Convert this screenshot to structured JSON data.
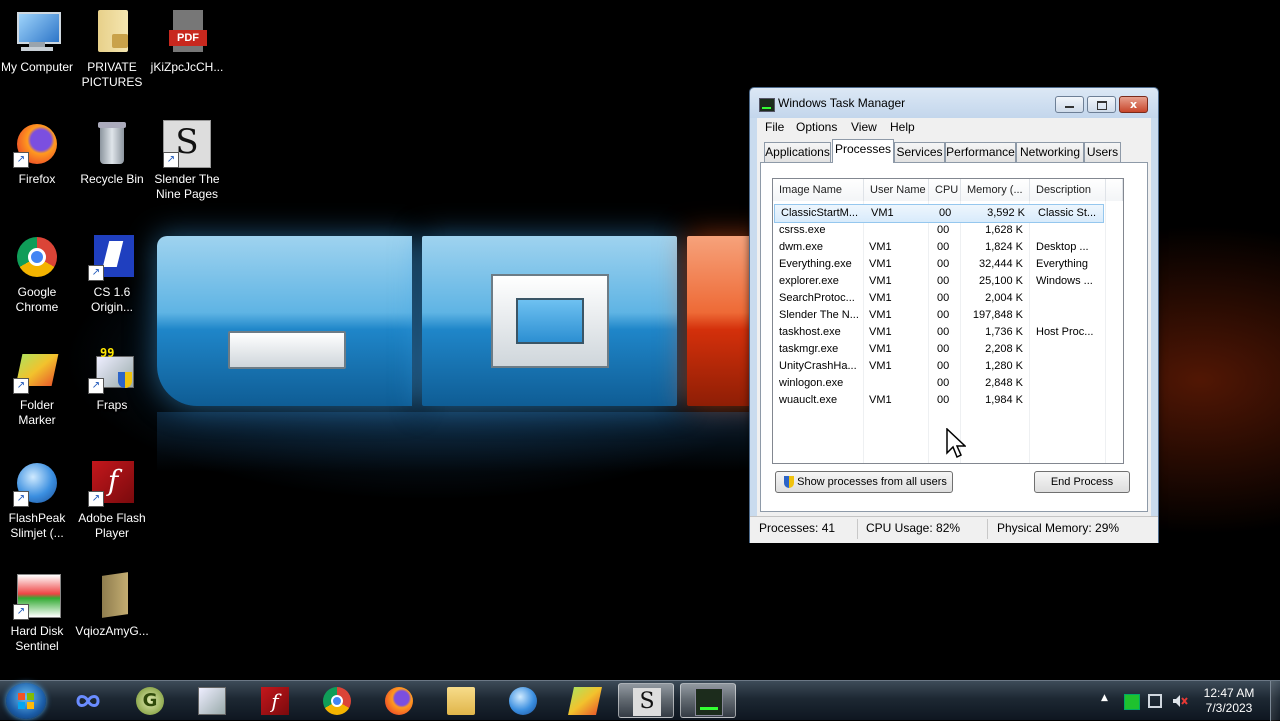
{
  "desktop": {
    "icons": [
      {
        "label": "My Computer"
      },
      {
        "label": "PRIVATE PICTURES"
      },
      {
        "label": "jKiZpcJcCH..."
      },
      {
        "label": "Firefox"
      },
      {
        "label": "Recycle Bin"
      },
      {
        "label": "Slender The Nine Pages"
      },
      {
        "label": "Google Chrome"
      },
      {
        "label": "CS 1.6 Origin..."
      },
      {
        "label": "Folder Marker"
      },
      {
        "label": "Fraps"
      },
      {
        "label": "FlashPeak Slimjet (..."
      },
      {
        "label": "Adobe Flash Player"
      },
      {
        "label": "Hard Disk Sentinel"
      },
      {
        "label": "VqiozAmyG..."
      }
    ],
    "pdf_badge": "PDF",
    "fraps_badge": "99",
    "slender_glyph": "S"
  },
  "task_manager": {
    "title": "Windows Task Manager",
    "menu": [
      "File",
      "Options",
      "View",
      "Help"
    ],
    "tabs": [
      "Applications",
      "Processes",
      "Services",
      "Performance",
      "Networking",
      "Users"
    ],
    "active_tab": "Processes",
    "columns": [
      "Image Name",
      "User Name",
      "CPU",
      "Memory (...",
      "Description"
    ],
    "processes": [
      {
        "name": "ClassicStartM...",
        "user": "VM1",
        "cpu": "00",
        "memory": "3,592 K",
        "description": "Classic St..."
      },
      {
        "name": "csrss.exe",
        "user": "",
        "cpu": "00",
        "memory": "1,628 K",
        "description": ""
      },
      {
        "name": "dwm.exe",
        "user": "VM1",
        "cpu": "00",
        "memory": "1,824 K",
        "description": "Desktop ..."
      },
      {
        "name": "Everything.exe",
        "user": "VM1",
        "cpu": "00",
        "memory": "32,444 K",
        "description": "Everything"
      },
      {
        "name": "explorer.exe",
        "user": "VM1",
        "cpu": "00",
        "memory": "25,100 K",
        "description": "Windows ..."
      },
      {
        "name": "SearchProtoc...",
        "user": "VM1",
        "cpu": "00",
        "memory": "2,004 K",
        "description": ""
      },
      {
        "name": "Slender The N...",
        "user": "VM1",
        "cpu": "00",
        "memory": "197,848 K",
        "description": ""
      },
      {
        "name": "taskhost.exe",
        "user": "VM1",
        "cpu": "00",
        "memory": "1,736 K",
        "description": "Host Proc..."
      },
      {
        "name": "taskmgr.exe",
        "user": "VM1",
        "cpu": "00",
        "memory": "2,208 K",
        "description": ""
      },
      {
        "name": "UnityCrashHa...",
        "user": "VM1",
        "cpu": "00",
        "memory": "1,280 K",
        "description": ""
      },
      {
        "name": "winlogon.exe",
        "user": "",
        "cpu": "00",
        "memory": "2,848 K",
        "description": ""
      },
      {
        "name": "wuauclt.exe",
        "user": "VM1",
        "cpu": "00",
        "memory": "1,984 K",
        "description": ""
      }
    ],
    "show_all_label": "Show processes from all users",
    "end_process_label": "End Process",
    "status": {
      "processes": "Processes: 41",
      "cpu": "CPU Usage: 82%",
      "memory": "Physical Memory: 29%"
    },
    "close_glyph": "x"
  },
  "taskbar": {
    "pinned": [
      "start-button",
      "infinity-app",
      "g-app",
      "fraps",
      "adobe-flash",
      "chrome",
      "firefox",
      "file-explorer",
      "slimjet",
      "folder-marker",
      "slender",
      "task-manager"
    ],
    "active": [
      "slender",
      "task-manager"
    ],
    "clock": {
      "time": "12:47 AM",
      "date": "7/3/2023"
    },
    "tray_arrow": "▲"
  },
  "colors": {
    "accent_blue": "#1f86c9",
    "accent_red": "#d4300b",
    "selection": "#d8ebfb"
  }
}
